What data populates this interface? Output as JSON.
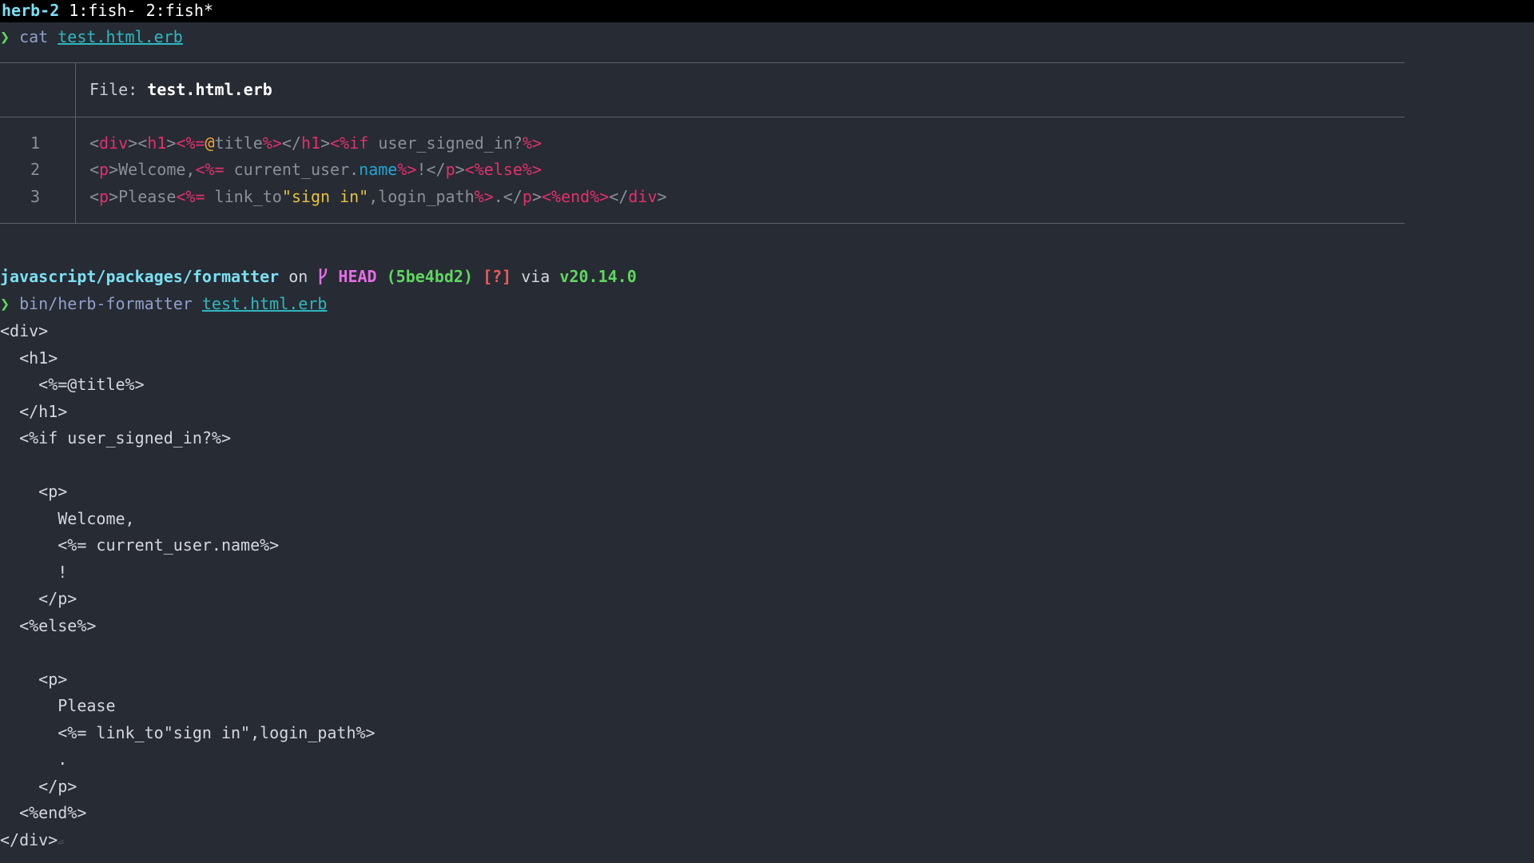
{
  "tmux": {
    "session": "herb-2",
    "windows": " 1:fish- 2:fish*"
  },
  "prompt1": {
    "arrow": "❯",
    "command": "cat",
    "argument": "test.html.erb"
  },
  "bat": {
    "file_label": "File: ",
    "file_name": "test.html.erb",
    "line_numbers": [
      "1",
      "2",
      "3"
    ],
    "lines": [
      [
        {
          "t": "<",
          "c": "plain"
        },
        {
          "t": "div",
          "c": "tag"
        },
        {
          "t": "><",
          "c": "plain"
        },
        {
          "t": "h1",
          "c": "tag"
        },
        {
          "t": ">",
          "c": "plain"
        },
        {
          "t": "<%=",
          "c": "erb"
        },
        {
          "t": "@",
          "c": "at"
        },
        {
          "t": "title",
          "c": "plain"
        },
        {
          "t": "%>",
          "c": "erb"
        },
        {
          "t": "</",
          "c": "plain"
        },
        {
          "t": "h1",
          "c": "tag"
        },
        {
          "t": ">",
          "c": "plain"
        },
        {
          "t": "<%if",
          "c": "erb"
        },
        {
          "t": " user_signed_in?",
          "c": "plain"
        },
        {
          "t": "%>",
          "c": "erb"
        }
      ],
      [
        {
          "t": "<",
          "c": "plain"
        },
        {
          "t": "p",
          "c": "tag"
        },
        {
          "t": ">Welcome,",
          "c": "plain"
        },
        {
          "t": "<%=",
          "c": "erb"
        },
        {
          "t": " current_user.",
          "c": "plain"
        },
        {
          "t": "name",
          "c": "meth"
        },
        {
          "t": "%>",
          "c": "erb"
        },
        {
          "t": "!</",
          "c": "plain"
        },
        {
          "t": "p",
          "c": "tag"
        },
        {
          "t": ">",
          "c": "plain"
        },
        {
          "t": "<%else%>",
          "c": "erb"
        }
      ],
      [
        {
          "t": "<",
          "c": "plain"
        },
        {
          "t": "p",
          "c": "tag"
        },
        {
          "t": ">Please",
          "c": "plain"
        },
        {
          "t": "<%=",
          "c": "erb"
        },
        {
          "t": " link_to",
          "c": "plain"
        },
        {
          "t": "\"sign in\"",
          "c": "str"
        },
        {
          "t": ",login_path",
          "c": "plain"
        },
        {
          "t": "%>",
          "c": "erb"
        },
        {
          "t": ".</",
          "c": "plain"
        },
        {
          "t": "p",
          "c": "tag"
        },
        {
          "t": ">",
          "c": "plain"
        },
        {
          "t": "<%end%>",
          "c": "erb"
        },
        {
          "t": "</",
          "c": "plain"
        },
        {
          "t": "div",
          "c": "tag"
        },
        {
          "t": ">",
          "c": "plain"
        }
      ]
    ]
  },
  "prompt2": {
    "directory": "javascript/packages/formatter",
    "on": " on ",
    "branch_icon": "",
    "branch": "HEAD",
    "hash": "(5be4bd2)",
    "status": "[?]",
    "via": " via ",
    "node_version": "v20.14.0",
    "arrow": "❯",
    "command": "bin/herb-formatter",
    "argument": "test.html.erb"
  },
  "output": [
    "<div>",
    "  <h1>",
    "    <%=@title%>",
    "  </h1>",
    "  <%if user_signed_in?%>",
    "",
    "    <p>",
    "      Welcome,",
    "      <%= current_user.name%>",
    "      !",
    "    </p>",
    "  <%else%>",
    "",
    "    <p>",
    "      Please",
    "      <%= link_to\"sign in\",login_path%>",
    "      .",
    "    </p>",
    "  <%end%>",
    "</div>"
  ],
  "eol_marker": "⏎"
}
